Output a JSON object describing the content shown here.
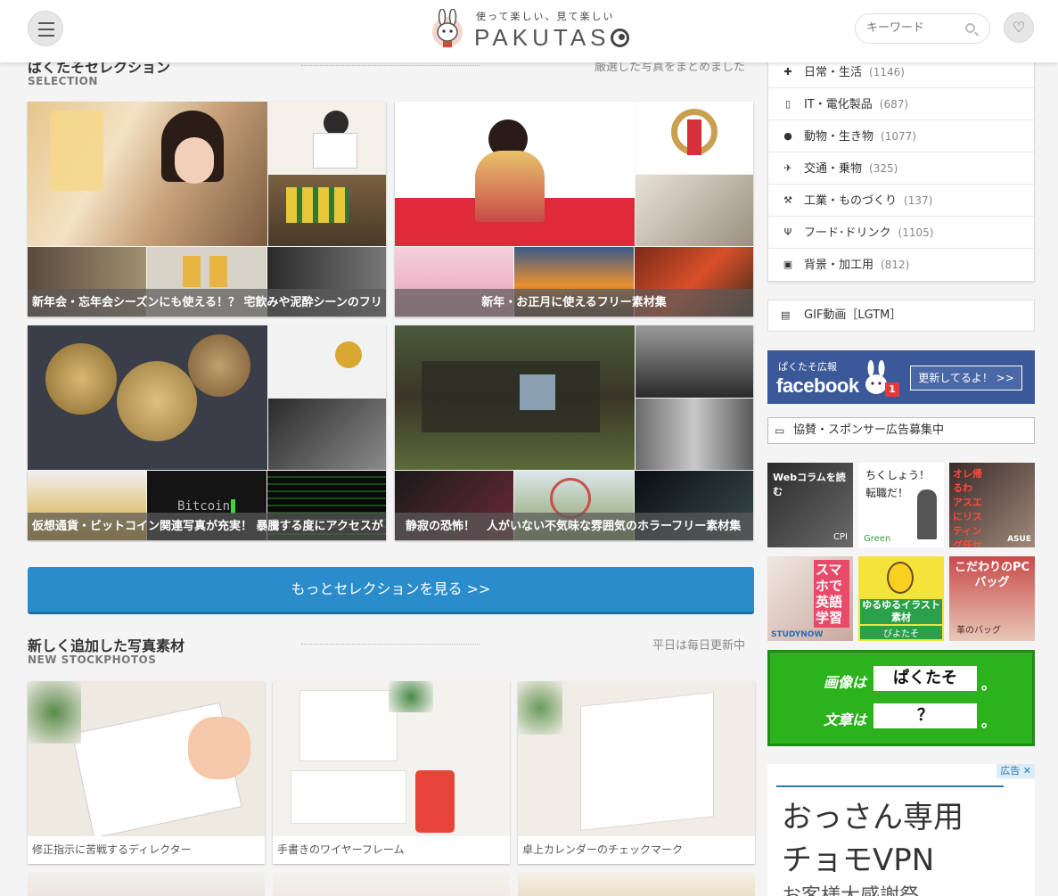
{
  "header": {
    "tagline": "使って楽しい、見て楽しい",
    "brand": "PAKUTAS",
    "search_placeholder": "キーワード",
    "menu_icon": "hamburger-icon",
    "favorite_icon": "heart-icon",
    "search_icon": "magnifier-icon"
  },
  "selection": {
    "title": "ぱくたそセレクション",
    "subtitle": "SELECTION",
    "note": "厳選した写真をまとめました",
    "tiles": [
      {
        "caption": "新年会・忘年会シーズンにも使える！？ 宅飲みや泥酔シーンのフリ"
      },
      {
        "caption": "新年・お正月に使えるフリー素材集"
      },
      {
        "caption": "仮想通貨・ビットコイン関連写真が充実！ 暴騰する度にアクセスが"
      },
      {
        "caption": "静寂の恐怖！　人がいない不気味な雰囲気のホラーフリー素材集"
      }
    ],
    "more_label": "もっとセレクションを見る >>"
  },
  "new_photos": {
    "title": "新しく追加した写真素材",
    "subtitle": "NEW STOCKPHOTOS",
    "note": "平日は毎日更新中",
    "items": [
      {
        "caption": "修正指示に苦戦するディレクター"
      },
      {
        "caption": "手書きのワイヤーフレーム"
      },
      {
        "caption": "卓上カレンダーのチェックマーク"
      }
    ]
  },
  "sidebar": {
    "categories": [
      {
        "label": "日常・生活",
        "count": "(1146)",
        "icon": "puzzle-icon"
      },
      {
        "label": "IT・電化製品",
        "count": "(687)",
        "icon": "mobile-icon"
      },
      {
        "label": "動物・生き物",
        "count": "(1077)",
        "icon": "globe-icon"
      },
      {
        "label": "交通・乗物",
        "count": "(325)",
        "icon": "plane-icon"
      },
      {
        "label": "工業・ものづくり",
        "count": "(137)",
        "icon": "wrench-icon"
      },
      {
        "label": "フード･ドリンク",
        "count": "(1105)",
        "icon": "utensils-icon"
      },
      {
        "label": "背景・加工用",
        "count": "(812)",
        "icon": "picture-icon"
      }
    ],
    "gif": {
      "label": "GIF動画［LGTM］",
      "icon": "film-file-icon"
    },
    "facebook": {
      "small": "ぱくたそ広報",
      "big": "facebook",
      "badge": "1",
      "button": "更新してるよ！ >>"
    },
    "sponsor": {
      "label": "協賛・スポンサー広告募集中",
      "icon": "monitor-icon"
    },
    "ads": [
      {
        "text": "Webコラムを読む",
        "brand": "CPI"
      },
      {
        "text": "ちくしょう！\n転職だ！",
        "brand": "Green"
      },
      {
        "text": "オレ帰るわ\nアスエにリスティング任せてあるし",
        "brand": "ASUE"
      },
      {
        "text": "スマホで英語学習",
        "brand": "STUDYNOW"
      },
      {
        "text": "ゆるゆるイラスト素材",
        "brand": "ぴよたそ"
      },
      {
        "text": "こだわりのPCバッグ",
        "brand": "革のバッグ"
      }
    ],
    "green_banner": {
      "row1_label": "画像は",
      "row1_box": "ぱくたそ",
      "row2_label": "文章は",
      "row2_box": "？",
      "dot": "。"
    },
    "ad_bottom": {
      "tag": "広告",
      "close": "✕",
      "line1": "おっさん専用",
      "line2": "チョモVPN",
      "line3": "お客様大感謝祭"
    }
  }
}
